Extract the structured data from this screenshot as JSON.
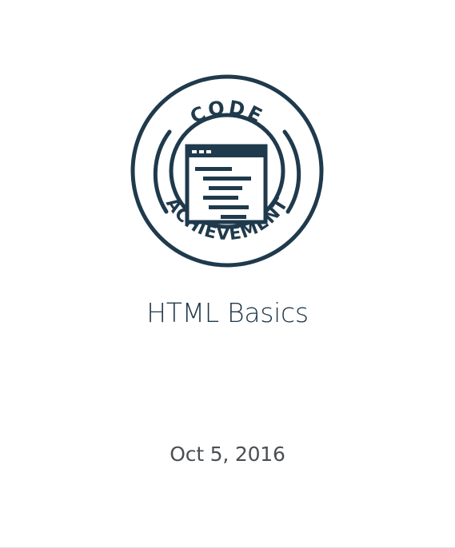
{
  "badge": {
    "icon": "code-achievement-badge-icon",
    "top_text": "CODE",
    "bottom_text": "ACHIEVEMENT",
    "color": "#1f3a4c"
  },
  "course": {
    "title": "HTML Basics"
  },
  "award": {
    "date": "Oct 5, 2016"
  },
  "colors": {
    "title": "#1f3849",
    "date": "#4a4f52",
    "background": "#ffffff"
  }
}
